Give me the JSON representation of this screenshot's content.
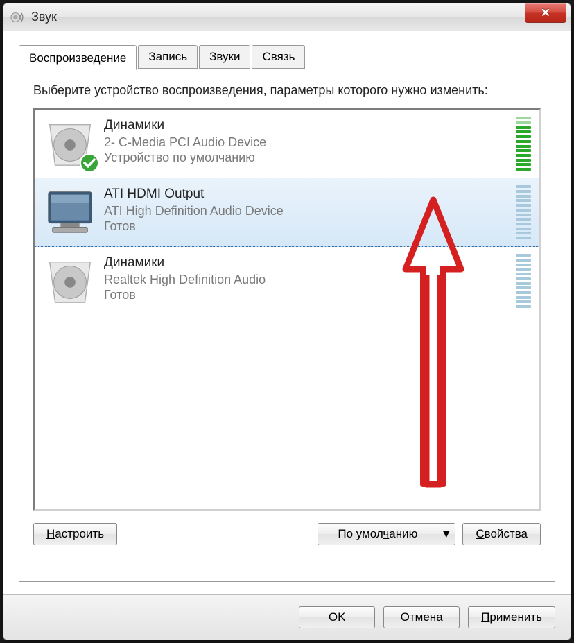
{
  "window": {
    "title": "Звук"
  },
  "tabs": {
    "playback": "Воспроизведение",
    "recording": "Запись",
    "sounds": "Звуки",
    "communications": "Связь"
  },
  "instruction": "Выберите устройство воспроизведения, параметры которого нужно изменить:",
  "devices": [
    {
      "name": "Динамики",
      "desc": "2- C-Media PCI Audio Device",
      "status": "Устройство по умолчанию",
      "meter": "green",
      "default": true,
      "icon": "speaker"
    },
    {
      "name": "ATI HDMI Output",
      "desc": "ATI High Definition Audio Device",
      "status": "Готов",
      "meter": "blue",
      "selected": true,
      "icon": "monitor"
    },
    {
      "name": "Динамики",
      "desc": "Realtek High Definition Audio",
      "status": "Готов",
      "meter": "blue",
      "icon": "speaker"
    }
  ],
  "buttons": {
    "configure": "Настроить",
    "setDefault": "По умолчанию",
    "properties": "Свойства",
    "ok": "OK",
    "cancel": "Отмена",
    "apply": "Применить"
  }
}
